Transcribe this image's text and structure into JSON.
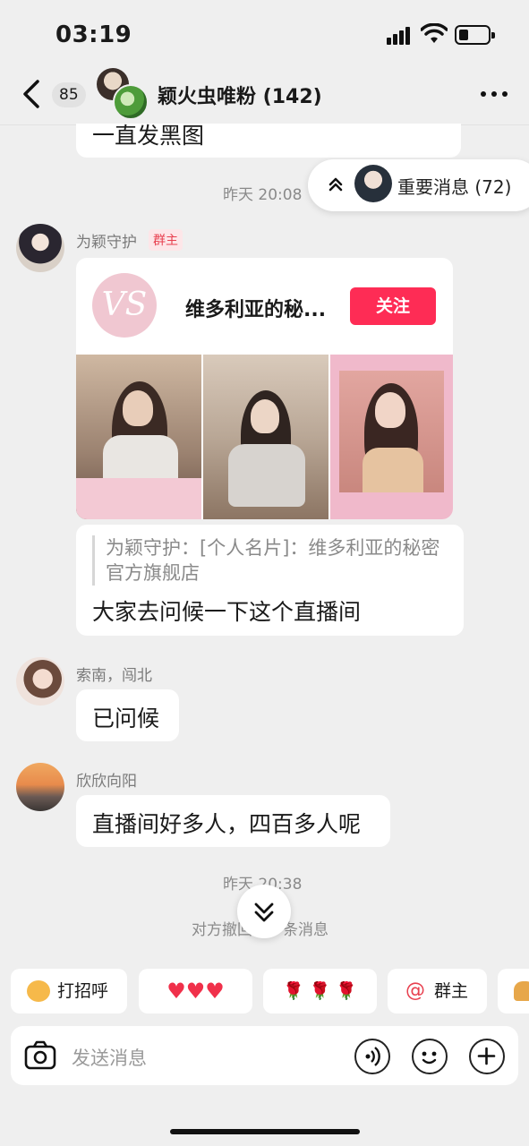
{
  "status": {
    "time": "03:19"
  },
  "header": {
    "unread_count": "85",
    "title": "颖火虫唯粉 (142)"
  },
  "messages": {
    "prev_bubble": "一直发黑图",
    "timestamp1": "昨天 20:08",
    "important": "重要消息 (72)",
    "sender1": {
      "name": "为颖守护",
      "badge": "群主"
    },
    "card": {
      "account_name": "维多利亚的秘...",
      "follow": "关注",
      "logo_text": "VS"
    },
    "quote": "为颖守护：[个人名片]：维多利亚的秘密官方旗舰店",
    "quote_reply": "大家去问候一下这个直播间",
    "sender2": {
      "name": "索南，闯北",
      "text": "已问候"
    },
    "sender3": {
      "name": "欣欣向阳",
      "text": "直播间好多人，四百多人呢"
    },
    "timestamp2": "昨天 20:38",
    "recall": "对方撤回了一条消息"
  },
  "chips": {
    "greet": "打招呼",
    "hearts": "♥♥♥",
    "roses": "🌹 🌹 🌹",
    "owner": "群主"
  },
  "input": {
    "placeholder": "发送消息"
  }
}
